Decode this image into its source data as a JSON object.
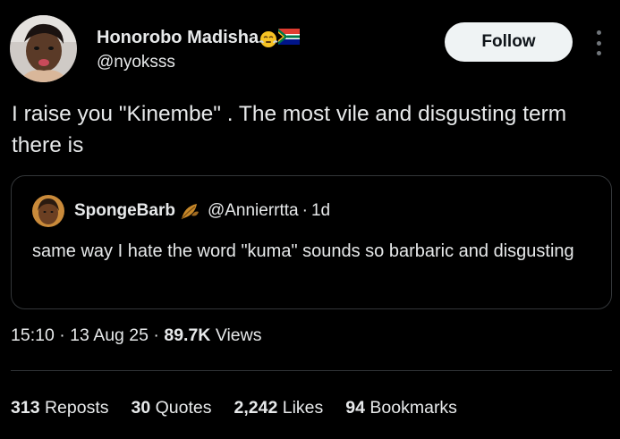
{
  "tweet": {
    "author": {
      "name": "Honorobo Madisha",
      "handle": "@nyoksss",
      "emojis": [
        "face-with-steam-icon",
        "south-africa-flag-icon"
      ]
    },
    "follow_label": "Follow",
    "text": "I raise you \"Kinembe\" . The most vile and disgusting term there is",
    "timestamp": "15:10",
    "date": "13 Aug 25",
    "views_count": "89.7K",
    "views_label": "Views",
    "separator": "·"
  },
  "quote": {
    "name": "SpongeBarb",
    "name_emoji": "leaf-icon",
    "handle": "@Annierrtta",
    "time": "1d",
    "text": "same way I hate the word \"kuma\" sounds so barbaric and disgusting"
  },
  "stats": [
    {
      "count": "313",
      "label": "Reposts"
    },
    {
      "count": "30",
      "label": "Quotes"
    },
    {
      "count": "2,242",
      "label": "Likes"
    },
    {
      "count": "94",
      "label": "Bookmarks"
    }
  ],
  "colors": {
    "background": "#000000",
    "text": "#e7e9ea",
    "muted": "#71767b",
    "border": "#333639",
    "follow_bg": "#eff3f4"
  }
}
